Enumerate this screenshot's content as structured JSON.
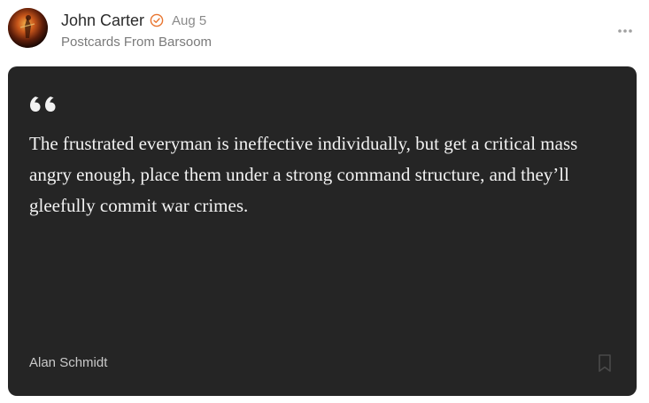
{
  "post": {
    "author_name": "John Carter",
    "date": "Aug 5",
    "publication": "Postcards From Barsoom",
    "verified_icon": "verified-check-icon",
    "more_icon": "more-horizontal-icon",
    "accent_color": "#e8742e"
  },
  "quote": {
    "text": "The frustrated everyman is ineffective individually, but get a critical mass angry enough, place them under a strong command structure, and they’ll gleefully commit war crimes.",
    "author": "Alan Schmidt",
    "quote_icon": "quote-mark-icon",
    "bookmark_icon": "bookmark-icon",
    "card_color": "#252525"
  }
}
